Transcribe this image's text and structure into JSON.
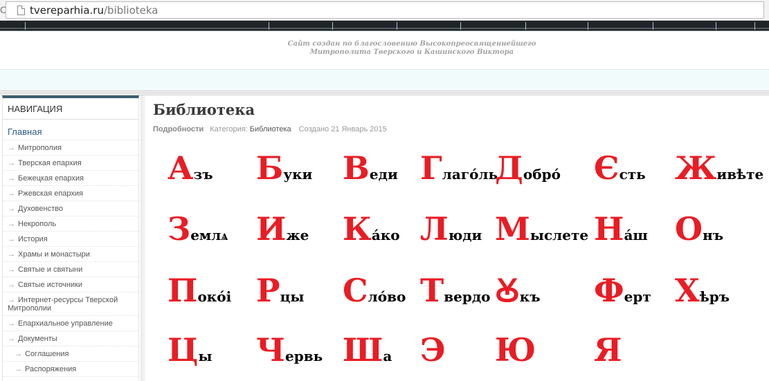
{
  "browser": {
    "url_host": "tvereparhia.ru",
    "url_path": "/biblioteka"
  },
  "header": {
    "blessing_line1": "Сайт создан по благословению Высокопреосвященнейшего",
    "blessing_line2": "Митрополита Тверского и Кашинского Виктора"
  },
  "sidebar": {
    "heading": "НАВИГАЦИЯ",
    "home": "Главная",
    "items": [
      {
        "label": "Митрополия"
      },
      {
        "label": "Тверская епархия"
      },
      {
        "label": "Бежецкая епархия"
      },
      {
        "label": "Ржевская епархия"
      },
      {
        "label": "Духовенство"
      },
      {
        "label": "Некрополь"
      },
      {
        "label": "История"
      },
      {
        "label": "Храмы и монастыри"
      },
      {
        "label": "Святые и святыни"
      },
      {
        "label": "Святые источники"
      },
      {
        "label": "Интернет-ресурсы Тверской Митрополии"
      },
      {
        "label": "Епархиальное управление"
      },
      {
        "label": "Документы"
      },
      {
        "label": "Соглашения"
      },
      {
        "label": "Распоряжения"
      }
    ]
  },
  "article": {
    "title": "Библиотека",
    "details_label": "Подробности",
    "category_prefix": "Категория:",
    "category": "Библиотека",
    "created": "Создано 21 Январь 2015"
  },
  "alphabet": [
    {
      "cap": "А",
      "rest": "зъ"
    },
    {
      "cap": "Б",
      "rest": "уки"
    },
    {
      "cap": "В",
      "rest": "еди"
    },
    {
      "cap": "Г",
      "rest": "лаго́ль"
    },
    {
      "cap": "Д",
      "rest": "обро́"
    },
    {
      "cap": "Є",
      "rest": "сть"
    },
    {
      "cap": "Ж",
      "rest": "ивѣте"
    },
    {
      "cap": "З",
      "rest": "емлѧ"
    },
    {
      "cap": "И",
      "rest": "же"
    },
    {
      "cap": "К",
      "rest": "а́ко"
    },
    {
      "cap": "Л",
      "rest": "юди"
    },
    {
      "cap": "М",
      "rest": "ыслете"
    },
    {
      "cap": "Н",
      "rest": "а́ш"
    },
    {
      "cap": "О",
      "rest": "нъ"
    },
    {
      "cap": "П",
      "rest": "окóі"
    },
    {
      "cap": "Р",
      "rest": "цы"
    },
    {
      "cap": "С",
      "rest": "ло́во"
    },
    {
      "cap": "Т",
      "rest": "вердо"
    },
    {
      "cap": "Ꙋ",
      "rest": "къ"
    },
    {
      "cap": "Ф",
      "rest": "ерт"
    },
    {
      "cap": "Х",
      "rest": "ѣръ"
    },
    {
      "cap": "Ц",
      "rest": "ы"
    },
    {
      "cap": "Ч",
      "rest": "ервь"
    },
    {
      "cap": "Ш",
      "rest": "а"
    },
    {
      "cap": "Э",
      "rest": ""
    },
    {
      "cap": "Ю",
      "rest": ""
    },
    {
      "cap": "Я",
      "rest": ""
    }
  ]
}
